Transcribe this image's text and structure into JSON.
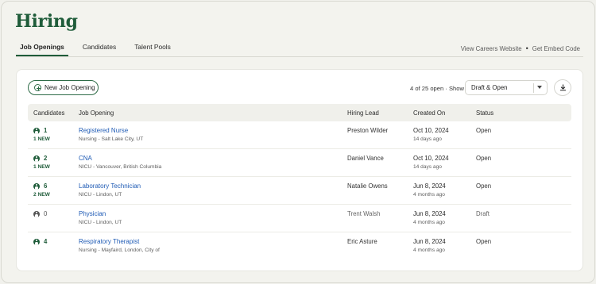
{
  "page": {
    "title": "Hiring"
  },
  "tabs": [
    {
      "label": "Job Openings",
      "active": true
    },
    {
      "label": "Candidates",
      "active": false
    },
    {
      "label": "Talent Pools",
      "active": false
    }
  ],
  "top_links": {
    "careers": "View Careers Website",
    "separator": "•",
    "embed": "Get Embed Code"
  },
  "toolbar": {
    "new_button": "New Job Opening",
    "count_text": "4 of 25 open · Show",
    "filter_value": "Draft & Open",
    "download_icon": "download-icon"
  },
  "table": {
    "headers": {
      "candidates": "Candidates",
      "job": "Job Opening",
      "lead": "Hiring Lead",
      "created": "Created On",
      "status": "Status"
    },
    "rows": [
      {
        "count": "1",
        "new": "1 NEW",
        "title": "Registered Nurse",
        "location": "Nursing - Salt Lake City, UT",
        "lead": "Preston Wilder",
        "created": "Oct 10, 2024",
        "ago": "14 days ago",
        "status": "Open"
      },
      {
        "count": "2",
        "new": "1 NEW",
        "title": "CNA",
        "location": "NICU - Vancouver, British Columbia",
        "lead": "Daniel Vance",
        "created": "Oct 10, 2024",
        "ago": "14 days ago",
        "status": "Open"
      },
      {
        "count": "6",
        "new": "2 NEW",
        "title": "Laboratory Technician",
        "location": "NICU - Lindon, UT",
        "lead": "Natalie Owens",
        "created": "Jun 8, 2024",
        "ago": "4 months ago",
        "status": "Open"
      },
      {
        "count": "0",
        "new": "",
        "title": "Physician",
        "location": "NICU - Lindon, UT",
        "lead": "Trent Walsh",
        "created": "Jun 8, 2024",
        "ago": "4 months ago",
        "status": "Draft"
      },
      {
        "count": "4",
        "new": "",
        "title": "Respiratory Therapist",
        "location": "Nursing - Mayfaird, London, City of",
        "lead": "Eric Asture",
        "created": "Jun 8, 2024",
        "ago": "4 months ago",
        "status": "Open"
      }
    ]
  },
  "colors": {
    "brand": "#1f5c3a",
    "link": "#1f5bb5"
  }
}
